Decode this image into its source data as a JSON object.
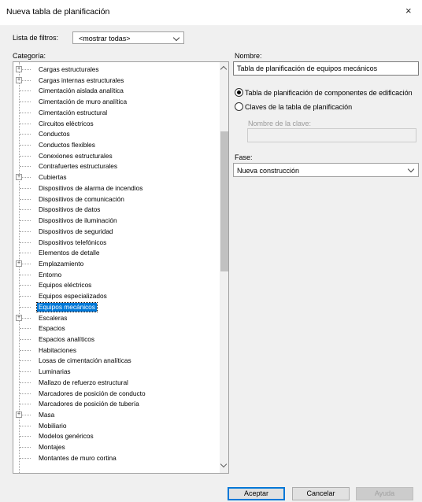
{
  "window": {
    "title": "Nueva tabla de planificación",
    "close_glyph": "×"
  },
  "filter": {
    "label": "Lista de filtros:",
    "value": "<mostrar todas>"
  },
  "category": {
    "label": "Categoría:",
    "selected_index": 23,
    "items": [
      {
        "label": "Cargas estructurales",
        "expandable": true
      },
      {
        "label": "Cargas internas estructurales",
        "expandable": true
      },
      {
        "label": "Cimentación aislada analítica",
        "expandable": false
      },
      {
        "label": "Cimentación de muro analítica",
        "expandable": false
      },
      {
        "label": "Cimentación estructural",
        "expandable": false
      },
      {
        "label": "Circuitos eléctricos",
        "expandable": false
      },
      {
        "label": "Conductos",
        "expandable": false
      },
      {
        "label": "Conductos flexibles",
        "expandable": false
      },
      {
        "label": "Conexiones estructurales",
        "expandable": false
      },
      {
        "label": "Contrafuertes estructurales",
        "expandable": false
      },
      {
        "label": "Cubiertas",
        "expandable": true
      },
      {
        "label": "Dispositivos de alarma de incendios",
        "expandable": false
      },
      {
        "label": "Dispositivos de comunicación",
        "expandable": false
      },
      {
        "label": "Dispositivos de datos",
        "expandable": false
      },
      {
        "label": "Dispositivos de iluminación",
        "expandable": false
      },
      {
        "label": "Dispositivos de seguridad",
        "expandable": false
      },
      {
        "label": "Dispositivos telefónicos",
        "expandable": false
      },
      {
        "label": "Elementos de detalle",
        "expandable": false
      },
      {
        "label": "Emplazamiento",
        "expandable": true
      },
      {
        "label": "Entorno",
        "expandable": false
      },
      {
        "label": "Equipos eléctricos",
        "expandable": false
      },
      {
        "label": "Equipos especializados",
        "expandable": false
      },
      {
        "label": "Equipos mecánicos",
        "expandable": false
      },
      {
        "label": "Escaleras",
        "expandable": true
      },
      {
        "label": "Espacios",
        "expandable": false
      },
      {
        "label": "Espacios analíticos",
        "expandable": false
      },
      {
        "label": "Habitaciones",
        "expandable": false
      },
      {
        "label": "Losas de cimentación analíticas",
        "expandable": false
      },
      {
        "label": "Luminarias",
        "expandable": false
      },
      {
        "label": "Mallazo de refuerzo estructural",
        "expandable": false
      },
      {
        "label": "Marcadores de posición de conducto",
        "expandable": false
      },
      {
        "label": "Marcadores de posición de tubería",
        "expandable": false
      },
      {
        "label": "Masa",
        "expandable": true
      },
      {
        "label": "Mobiliario",
        "expandable": false
      },
      {
        "label": "Modelos genéricos",
        "expandable": false
      },
      {
        "label": "Montajes",
        "expandable": false
      },
      {
        "label": "Montantes de muro cortina",
        "expandable": false
      }
    ]
  },
  "name": {
    "label": "Nombre:",
    "value": "Tabla de planificación de equipos mecánicos"
  },
  "options": {
    "building_components": {
      "label": "Tabla de planificación de componentes de edificación",
      "checked": true
    },
    "key_schedule": {
      "label": "Claves de la tabla de planificación",
      "checked": false
    },
    "key_name_label": "Nombre de la clave:",
    "key_name_value": ""
  },
  "phase": {
    "label": "Fase:",
    "value": "Nueva construcción"
  },
  "buttons": {
    "ok": "Aceptar",
    "cancel": "Cancelar",
    "help": "Ayuda"
  }
}
